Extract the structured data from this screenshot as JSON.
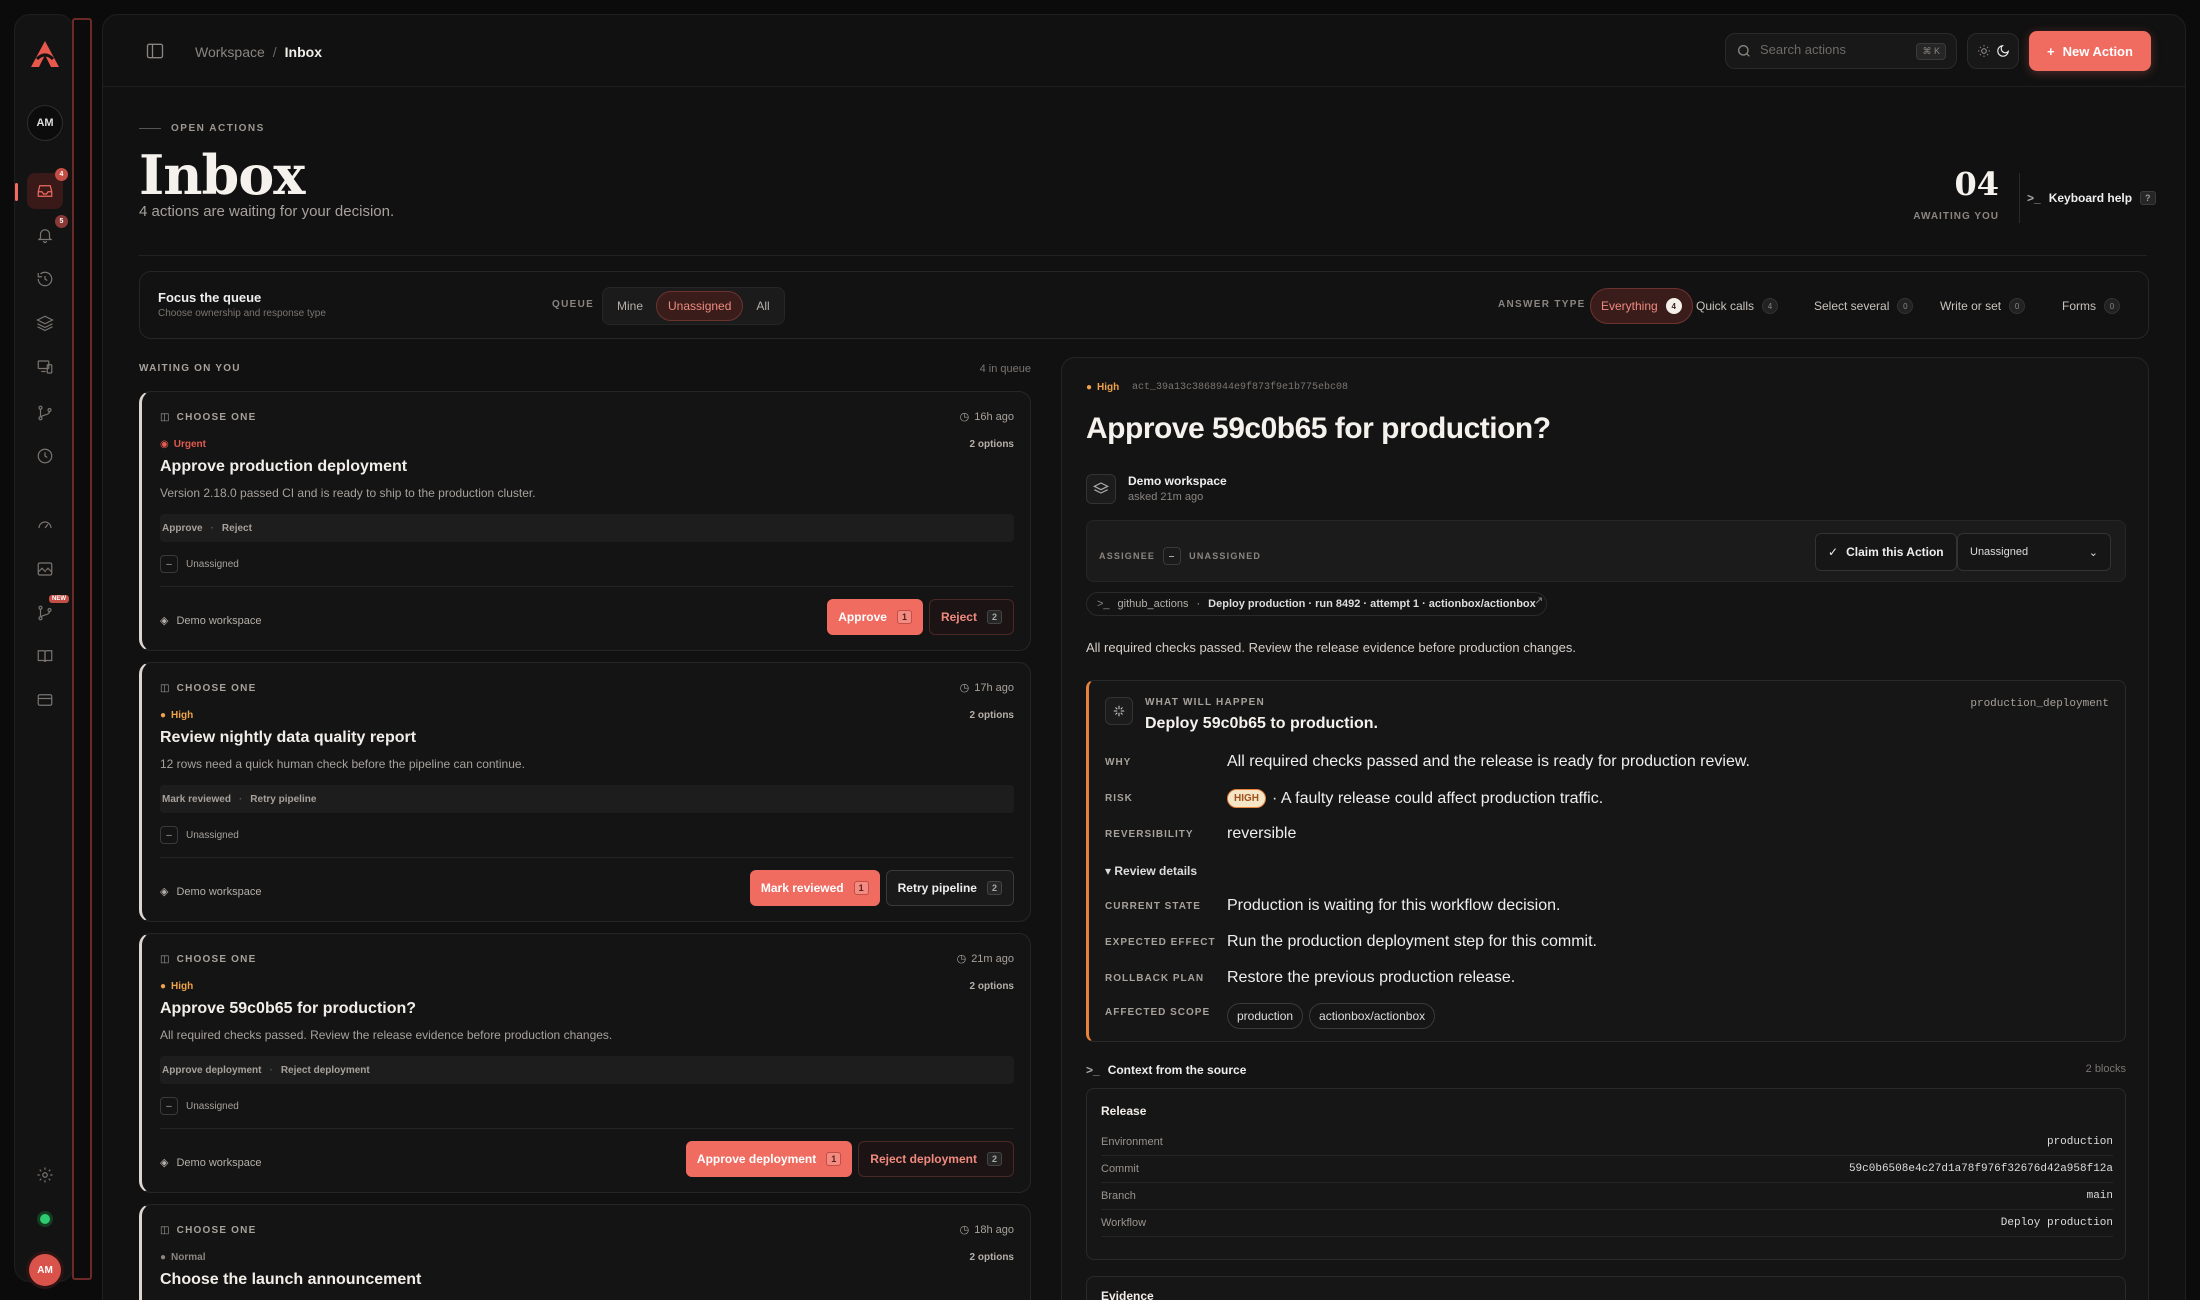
{
  "rail": {
    "avatar": "AM",
    "user_initials": "AM",
    "inbox_badge": "4",
    "notif_badge": "5",
    "new_label": "NEW"
  },
  "topbar": {
    "breadcrumb_root": "Workspace",
    "breadcrumb_sep": "/",
    "breadcrumb_current": "Inbox",
    "search_placeholder": "Search actions",
    "search_shortcut": "⌘ K",
    "new_action_label": "New Action"
  },
  "header": {
    "eyebrow": "OPEN ACTIONS",
    "title": "Inbox",
    "subtitle": "4 actions are waiting for your decision.",
    "count": "04",
    "count_label": "AWAITING YOU",
    "keyboard_help": "Keyboard help",
    "keyboard_help_key": "?"
  },
  "filters": {
    "title": "Focus the queue",
    "subtitle": "Choose ownership and response type",
    "queue_label": "QUEUE",
    "queue_options": [
      "Mine",
      "Unassigned",
      "All"
    ],
    "answer_type_label": "ANSWER TYPE",
    "answer_types": [
      {
        "label": "Everything",
        "count": "4"
      },
      {
        "label": "Quick calls",
        "count": "4"
      },
      {
        "label": "Select several",
        "count": "0"
      },
      {
        "label": "Write or set",
        "count": "0"
      },
      {
        "label": "Forms",
        "count": "0"
      }
    ]
  },
  "queue": {
    "heading": "WAITING ON YOU",
    "count_text": "4 in queue",
    "cards": [
      {
        "type": "CHOOSE ONE",
        "time": "16h ago",
        "priority": "Urgent",
        "options": "2 options",
        "title": "Approve production deployment",
        "description": "Version 2.18.0 passed CI and is ready to ship to the production cluster.",
        "choice_a": "Approve",
        "choice_b": "Reject",
        "assignee": "Unassigned",
        "workspace": "Demo workspace",
        "primary_label": "Approve",
        "primary_key": "1",
        "secondary_label": "Reject",
        "secondary_key": "2"
      },
      {
        "type": "CHOOSE ONE",
        "time": "17h ago",
        "priority": "High",
        "options": "2 options",
        "title": "Review nightly data quality report",
        "description": "12 rows need a quick human check before the pipeline can continue.",
        "choice_a": "Mark reviewed",
        "choice_b": "Retry pipeline",
        "assignee": "Unassigned",
        "workspace": "Demo workspace",
        "primary_label": "Mark reviewed",
        "primary_key": "1",
        "secondary_label": "Retry pipeline",
        "secondary_key": "2"
      },
      {
        "type": "CHOOSE ONE",
        "time": "21m ago",
        "priority": "High",
        "options": "2 options",
        "title": "Approve 59c0b65 for production?",
        "description": "All required checks passed. Review the release evidence before production changes.",
        "choice_a": "Approve deployment",
        "choice_b": "Reject deployment",
        "assignee": "Unassigned",
        "workspace": "Demo workspace",
        "primary_label": "Approve deployment",
        "primary_key": "1",
        "secondary_label": "Reject deployment",
        "secondary_key": "2"
      },
      {
        "type": "CHOOSE ONE",
        "time": "18h ago",
        "priority": "Normal",
        "options": "2 options",
        "title": "Choose the launch announcement"
      }
    ]
  },
  "detail": {
    "priority": "High",
    "id": "act_39a13c3868944e9f873f9e1b775ebc08",
    "title": "Approve 59c0b65 for production?",
    "workspace": "Demo workspace",
    "asked": "asked 21m ago",
    "assignee_label": "ASSIGNEE",
    "assignee_value": "UNASSIGNED",
    "claim_label": "Claim this Action",
    "assign_select": "Unassigned",
    "source_actor": "github_actions",
    "source_desc": "Deploy production · run 8492 · attempt 1 · actionbox/actionbox",
    "summary": "All required checks passed. Review the release evidence before production changes.",
    "wwh": {
      "eyebrow": "WHAT WILL HAPPEN",
      "title": "Deploy 59c0b65 to production.",
      "code": "production_deployment",
      "why_label": "WHY",
      "why": "All required checks passed and the release is ready for production review.",
      "risk_label": "RISK",
      "risk_badge": "HIGH",
      "risk": "· A faulty release could affect production traffic.",
      "rev_label": "REVERSIBILITY",
      "rev": "reversible",
      "review_toggle": "▾ Review details",
      "state_label": "CURRENT STATE",
      "state": "Production is waiting for this workflow decision.",
      "effect_label": "EXPECTED EFFECT",
      "effect": "Run the production deployment step for this commit.",
      "rollback_label": "ROLLBACK PLAN",
      "rollback": "Restore the previous production release.",
      "scope_label": "AFFECTED SCOPE",
      "scope": [
        "production",
        "actionbox/actionbox"
      ]
    },
    "context": {
      "title": "Context from the source",
      "blocks": "2 blocks",
      "release_title": "Release",
      "rows": [
        {
          "k": "Environment",
          "v": "production"
        },
        {
          "k": "Commit",
          "v": "59c0b6508e4c27d1a78f976f32676d42a958f12a"
        },
        {
          "k": "Branch",
          "v": "main"
        },
        {
          "k": "Workflow",
          "v": "Deploy production"
        }
      ],
      "evidence_title": "Evidence"
    }
  },
  "colors": {
    "accent": "#f06b60",
    "urgent": "#e05a4f",
    "high": "#f0a24a",
    "normal": "#8a8581",
    "bg": "#0b0b0b"
  }
}
